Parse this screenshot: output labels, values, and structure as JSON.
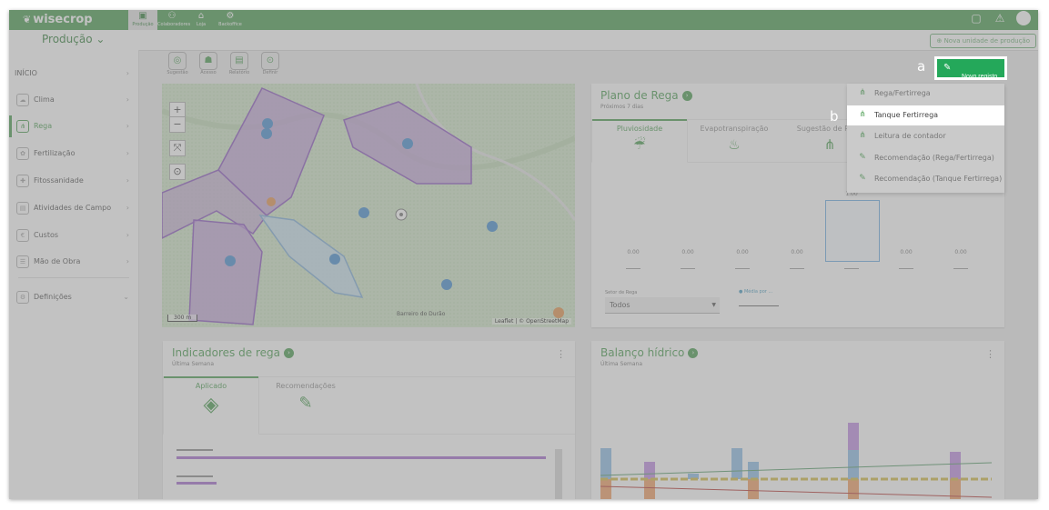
{
  "app": {
    "logo": "wisecrop"
  },
  "topnav": [
    {
      "label": "Produção",
      "icon": "production-icon",
      "glyph": "▣",
      "active": true
    },
    {
      "label": "Colaboradores",
      "icon": "collaborators-icon",
      "glyph": "⚇",
      "active": false
    },
    {
      "label": "Loja",
      "icon": "store-icon",
      "glyph": "⌂",
      "active": false
    },
    {
      "label": "Backoffice",
      "icon": "backoffice-icon",
      "glyph": "⚙",
      "active": false
    }
  ],
  "subbar": {
    "production_selector": "Produção",
    "add_unit_label": "Nova unidade de produção"
  },
  "sidebar": {
    "items": [
      {
        "label": "INÍCIO",
        "icon": "",
        "glyph": ""
      },
      {
        "label": "Clima",
        "icon": "cloud-icon",
        "glyph": "☁"
      },
      {
        "label": "Rega",
        "icon": "irrigation-icon",
        "glyph": "⋔"
      },
      {
        "label": "Fertilização",
        "icon": "fertilization-icon",
        "glyph": "✿"
      },
      {
        "label": "Fitossanidade",
        "icon": "plant-health-icon",
        "glyph": "✚"
      },
      {
        "label": "Atividades de Campo",
        "icon": "field-activity-icon",
        "glyph": "▤"
      },
      {
        "label": "Custos",
        "icon": "costs-icon",
        "glyph": "€"
      },
      {
        "label": "Mão de Obra",
        "icon": "labor-icon",
        "glyph": "☰"
      },
      {
        "label": "Definições",
        "icon": "settings-icon",
        "glyph": "⚙"
      }
    ]
  },
  "tools": [
    {
      "label": "Sugestão",
      "glyph": "◎"
    },
    {
      "label": "Acesso",
      "glyph": "☗"
    },
    {
      "label": "Relatório",
      "glyph": "▤"
    },
    {
      "label": "Definir",
      "glyph": "⊙"
    }
  ],
  "map": {
    "scale": "300 m",
    "attribution": "Leaflet | © OpenStreetMap",
    "place": "Barreiro do Durão"
  },
  "plano_rega": {
    "title": "Plano de Rega",
    "subtitle": "Próximos 7 dias",
    "tabs": [
      "Pluviosidade",
      "Evapotranspiração",
      "Sugestão de Rega"
    ],
    "bar_values": [
      "0.00",
      "0.00",
      "0.00",
      "0.00",
      "1.00",
      "0.00",
      "0.00"
    ],
    "setor_label": "Setor de Rega",
    "setor_value": "Todos",
    "legend": "Média por ..."
  },
  "indicadores": {
    "title": "Indicadores de rega",
    "subtitle": "Última Semana",
    "tabs": [
      "Aplicado",
      "Recomendações"
    ]
  },
  "balanco": {
    "title": "Balanço hídrico",
    "subtitle": "Última Semana"
  },
  "novo_registo": {
    "label": "Novo registo"
  },
  "dropdown": [
    {
      "label": "Rega/Fertirrega",
      "icon": "irrigation-icon"
    },
    {
      "label": "Tanque Fertirrega",
      "icon": "tank-irrigation-icon"
    },
    {
      "label": "Leitura de contador",
      "icon": "meter-reading-icon"
    },
    {
      "label": "Recomendação (Rega/Fertirrega)",
      "icon": "recommendation-icon"
    },
    {
      "label": "Recomendação (Tanque Fertirrega)",
      "icon": "recommendation-tank-icon"
    }
  ],
  "callouts": {
    "a": "a",
    "b": "b"
  }
}
